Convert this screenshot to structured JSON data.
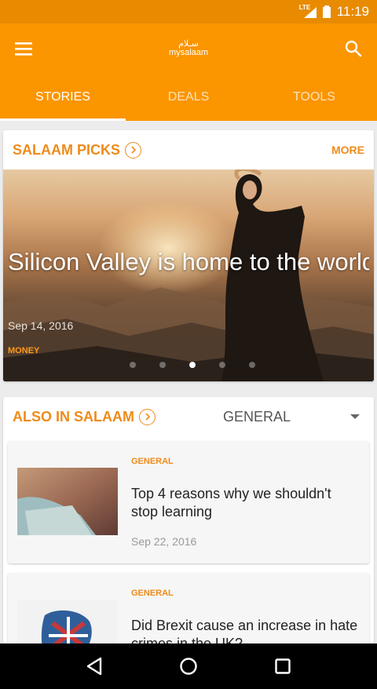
{
  "status_bar": {
    "network": "LTE",
    "time": "11:19"
  },
  "app_bar": {
    "logo_arabic": "سـلام",
    "logo_text": "mysalaam"
  },
  "tabs": [
    {
      "label": "STORIES",
      "active": true
    },
    {
      "label": "DEALS",
      "active": false
    },
    {
      "label": "TOOLS",
      "active": false
    }
  ],
  "picks": {
    "title": "SALAAM PICKS",
    "more_label": "MORE",
    "featured": {
      "title": "Silicon Valley is home to the world’s largest seller of mode…",
      "date": "Sep 14, 2016",
      "category": "MONEY"
    },
    "carousel": {
      "count": 5,
      "active_index": 2
    }
  },
  "also": {
    "title": "ALSO IN SALAAM",
    "filter_value": "GENERAL",
    "stories": [
      {
        "category": "GENERAL",
        "title": "Top 4 reasons why we shouldn't stop learning",
        "date": "Sep 22, 2016"
      },
      {
        "category": "GENERAL",
        "title": "Did Brexit cause an increase in hate crimes in the UK?",
        "date": ""
      }
    ]
  },
  "colors": {
    "primary": "#fb9500",
    "status_bar": "#e88b00",
    "accent": "#ee8b1a"
  },
  "icons": [
    "menu-icon",
    "search-icon",
    "chevron-right-icon",
    "dropdown-caret-icon",
    "back-icon",
    "home-icon",
    "recents-icon"
  ]
}
